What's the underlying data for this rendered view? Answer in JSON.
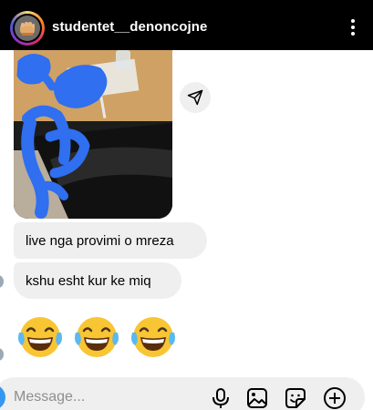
{
  "header": {
    "username": "studentet__denoncojne",
    "avatar_icon": "fist-icon",
    "menu_icon": "more-vertical-icon"
  },
  "thread": {
    "photo": {
      "description_icon": "photo-icon",
      "share_icon": "send-icon"
    },
    "messages": [
      {
        "text": "live nga provimi o mreza"
      },
      {
        "text": "kshu esht kur ke miq"
      }
    ],
    "emojis": [
      "😂",
      "😂",
      "😂"
    ]
  },
  "composer": {
    "placeholder": "Message...",
    "icons": [
      "microphone-icon",
      "gallery-icon",
      "sticker-icon",
      "add-icon"
    ]
  },
  "colors": {
    "header_bg": "#000000",
    "bubble_bg": "#efefef",
    "accent": "#3797f0",
    "scribble": "#2f6ff0"
  }
}
